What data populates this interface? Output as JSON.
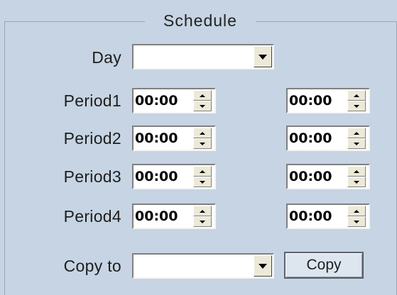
{
  "group_title": "Schedule",
  "day": {
    "label": "Day",
    "value": ""
  },
  "periods": [
    {
      "label": "Period1",
      "start": "00:00",
      "end": "00:00"
    },
    {
      "label": "Period2",
      "start": "00:00",
      "end": "00:00"
    },
    {
      "label": "Period3",
      "start": "00:00",
      "end": "00:00"
    },
    {
      "label": "Period4",
      "start": "00:00",
      "end": "00:00"
    }
  ],
  "copy_to": {
    "label": "Copy to",
    "value": ""
  },
  "copy_button": "Copy",
  "colors": {
    "panel_bg": "#c6d4e3",
    "field_bg": "#ffffff",
    "button_face": "#ece9d8"
  }
}
